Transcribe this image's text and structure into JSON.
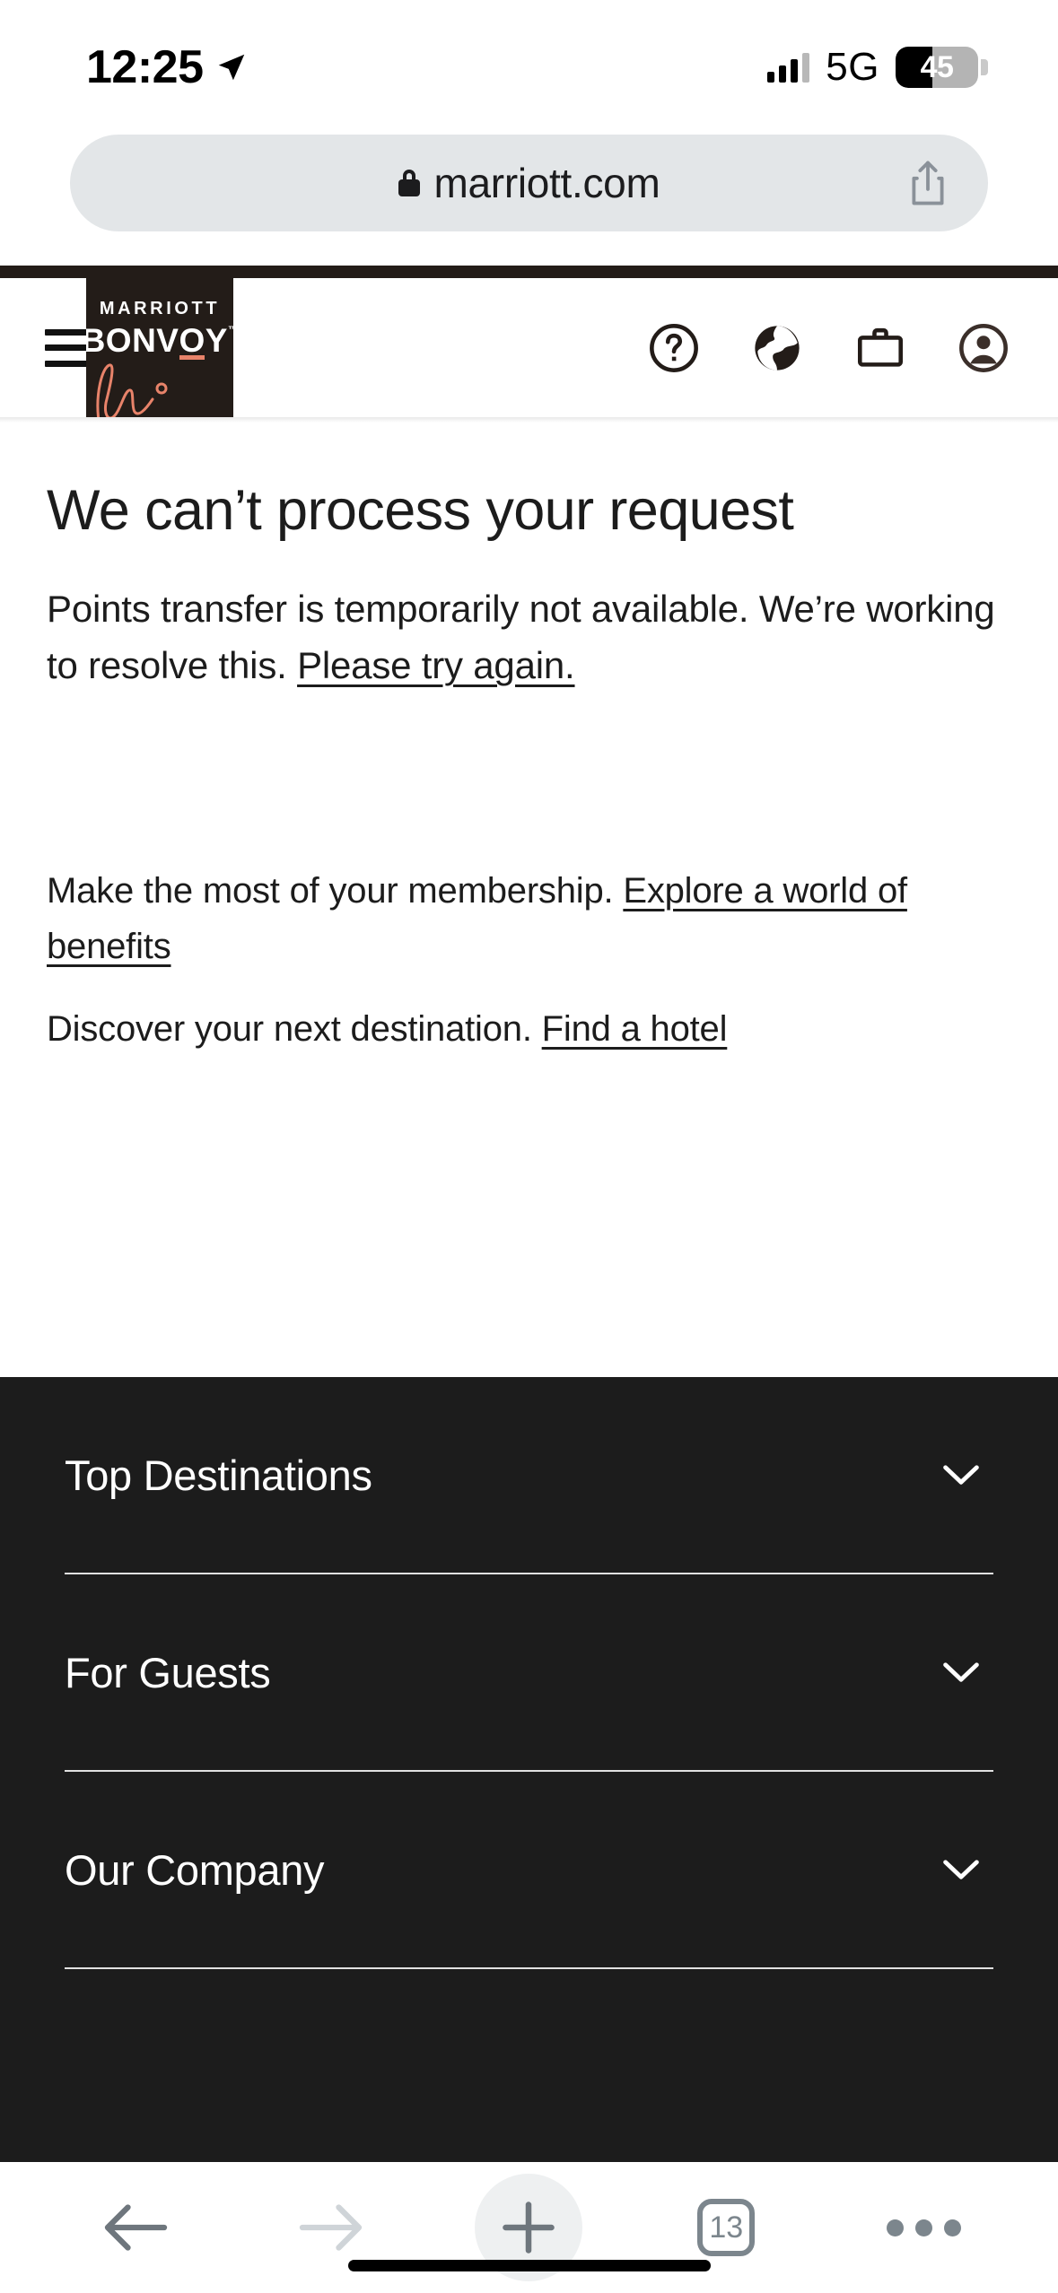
{
  "status_bar": {
    "time": "12:25",
    "location_icon": "location-arrow-icon",
    "signal_icon": "cellular-bars-icon",
    "network": "5G",
    "battery_percent": "45",
    "battery_level": 45
  },
  "browser": {
    "url": "marriott.com",
    "lock_icon": "lock-icon",
    "share_icon": "share-icon",
    "toolbar": {
      "back_label": "back-arrow-icon",
      "forward_label": "forward-arrow-icon",
      "new_tab_label": "plus-icon",
      "tab_count": "13",
      "more_label": "more-dots-icon"
    }
  },
  "site_header": {
    "menu_icon": "hamburger-menu-icon",
    "logo": {
      "line1": "MARRIOTT",
      "line2_a": "BONV",
      "line2_o": "O",
      "line2_b": "Y",
      "tm": "™"
    },
    "icons": [
      {
        "name": "help-icon",
        "label": "Help"
      },
      {
        "name": "globe-icon",
        "label": "Language"
      },
      {
        "name": "briefcase-icon",
        "label": "Trips"
      },
      {
        "name": "account-icon",
        "label": "Account"
      }
    ]
  },
  "main": {
    "heading": "We can’t process your request",
    "body_text_1": "Points transfer is temporarily not available. We’re working to resolve this. ",
    "body_link_1": "Please try again.",
    "promo_1_text": "Make the most of your membership. ",
    "promo_1_link": "Explore a world of benefits",
    "promo_2_text": "Discover your next destination. ",
    "promo_2_link": "Find a hotel"
  },
  "footer": {
    "background": "#1c1c1c",
    "sections": [
      {
        "label": "Top Destinations",
        "chevron": "chevron-down-icon"
      },
      {
        "label": "For Guests",
        "chevron": "chevron-down-icon"
      },
      {
        "label": "Our Company",
        "chevron": "chevron-down-icon"
      }
    ]
  },
  "colors": {
    "brand_dark": "#231c18",
    "brand_accent": "#e8836a",
    "footer_bg": "#1c1c1c",
    "url_bar_bg": "#e3e6e8",
    "toolbar_icon": "#7c868d"
  }
}
